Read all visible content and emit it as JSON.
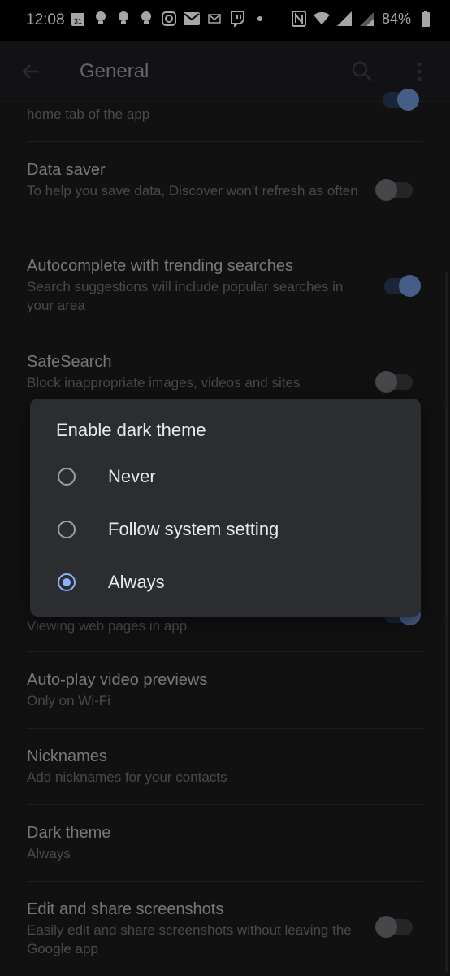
{
  "status_bar": {
    "time": "12:08",
    "calendar_day": "31",
    "battery": "84%"
  },
  "app_bar": {
    "title": "General"
  },
  "settings": [
    {
      "title": "",
      "subtitle": "home tab of the app",
      "toggle": "on"
    },
    {
      "title": "Data saver",
      "subtitle": "To help you save data, Discover won't refresh as often",
      "toggle": "off"
    },
    {
      "title": "Autocomplete with trending searches",
      "subtitle": "Search suggestions will include popular searches in your area",
      "toggle": "on"
    },
    {
      "title": "SafeSearch",
      "subtitle": "Block inappropriate images, videos and sites",
      "toggle": "off"
    },
    {
      "title": "",
      "subtitle": "Viewing web pages in app",
      "toggle": "on"
    },
    {
      "title": "Auto-play video previews",
      "subtitle": "Only on Wi-Fi"
    },
    {
      "title": "Nicknames",
      "subtitle": "Add nicknames for your contacts"
    },
    {
      "title": "Dark theme",
      "subtitle": "Always"
    },
    {
      "title": "Edit and share screenshots",
      "subtitle": "Easily edit and share screenshots without leaving the Google app",
      "toggle": "off"
    }
  ],
  "dialog": {
    "title": "Enable dark theme",
    "options": [
      "Never",
      "Follow system setting",
      "Always"
    ],
    "selected": "Always"
  },
  "colors": {
    "accent": "#8ab4f8",
    "background": "#1b1b1c",
    "dialog": "#2c2d31"
  }
}
